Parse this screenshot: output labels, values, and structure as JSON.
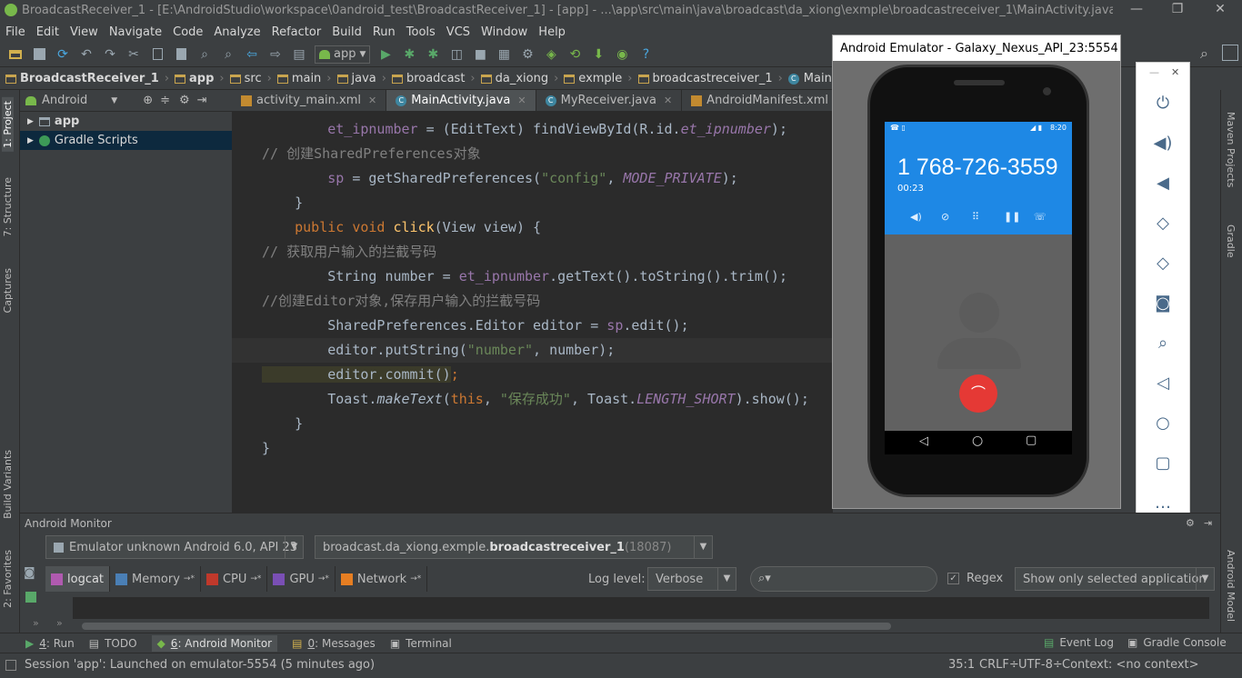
{
  "window": {
    "title": "BroadcastReceiver_1 - [E:\\AndroidStudio\\workspace\\0android_test\\BroadcastReceiver_1] - [app] - ...\\app\\src\\main\\java\\broadcast\\da_xiong\\exmple\\broadcastreceiver_1\\MainActivity.java - Android Studio ...",
    "minimize": "—",
    "restore": "❐",
    "close": "✕"
  },
  "menu": [
    "File",
    "Edit",
    "View",
    "Navigate",
    "Code",
    "Analyze",
    "Refactor",
    "Build",
    "Run",
    "Tools",
    "VCS",
    "Window",
    "Help"
  ],
  "toolbar": {
    "run_config": "app",
    "help": "?"
  },
  "breadcrumbs": [
    "BroadcastReceiver_1",
    "app",
    "src",
    "main",
    "java",
    "broadcast",
    "da_xiong",
    "exmple",
    "broadcastreceiver_1",
    "MainActivity"
  ],
  "left_tools": {
    "project": "1: Project",
    "structure": "7: Structure",
    "captures": "Captures",
    "build_variants": "Build Variants",
    "favorites": "2: Favorites"
  },
  "right_tools": {
    "maven": "Maven Projects",
    "gradle": "Gradle",
    "android_model": "Android Model"
  },
  "project_panel": {
    "view": "Android",
    "items": [
      "app",
      "Gradle Scripts"
    ]
  },
  "editor_tabs": [
    {
      "label": "activity_main.xml",
      "icon": "xml"
    },
    {
      "label": "MainActivity.java",
      "icon": "C"
    },
    {
      "label": "MyReceiver.java",
      "icon": "C"
    },
    {
      "label": "AndroidManifest.xml",
      "icon": "xml"
    }
  ],
  "code": {
    "l1a": "        et_ipnumber",
    "l1b": " = (EditText) findViewById(R.id.",
    "l1c": "et_ipnumber",
    "l1d": ");",
    "l2": "// 创建SharedPreferences对象",
    "l3a": "        sp",
    "l3b": " = getSharedPreferences(",
    "l3c": "\"config\"",
    "l3d": ", ",
    "l3e": "MODE_PRIVATE",
    "l3f": ");",
    "l4": "    }",
    "l5a": "    public void ",
    "l5b": "click",
    "l5c": "(View view) {",
    "l6": "// 获取用户输入的拦截号码",
    "l7a": "        String number = ",
    "l7b": "et_ipnumber",
    "l7c": ".getText().toString().trim();",
    "l8": "//创建Editor对象,保存用户输入的拦截号码",
    "l9a": "        SharedPreferences.Editor editor = ",
    "l9b": "sp",
    "l9c": ".edit();",
    "l10a": "        editor.putString(",
    "l10b": "\"number\"",
    "l10c": ", number);",
    "l11a": "        editor.commit()",
    "l11b": ";",
    "l12a": "        Toast.",
    "l12b": "makeText",
    "l12c": "(",
    "l12d": "this",
    "l12e": ", ",
    "l12f": "\"保存成功\"",
    "l12g": ", Toast.",
    "l12h": "LENGTH_SHORT",
    "l12i": ").show();",
    "l13": "    }",
    "l14": "}"
  },
  "emulator": {
    "title": "Android Emulator - Galaxy_Nexus_API_23:5554",
    "status_time": "8:20",
    "phone_number": "1 768-726-3559",
    "call_timer": "00:23"
  },
  "monitor": {
    "title": "Android Monitor",
    "device": "Emulator unknown Android 6.0, API 23",
    "process_prefix": "broadcast.da_xiong.exmple.",
    "process_bold": "broadcastreceiver_1",
    "process_pid": " (18087)",
    "tabs": [
      "logcat",
      "Memory",
      "CPU",
      "GPU",
      "Network"
    ],
    "log_level_label": "Log level:",
    "log_level": "Verbose",
    "search_placeholder": "",
    "regex": "Regex",
    "filter": "Show only selected application"
  },
  "bottom_tabs": [
    {
      "key": "4",
      "label": ": Run"
    },
    {
      "key": "",
      "label": "TODO"
    },
    {
      "key": "6",
      "label": ": Android Monitor"
    },
    {
      "key": "0",
      "label": ": Messages"
    },
    {
      "key": "",
      "label": "Terminal"
    }
  ],
  "bottom_right": {
    "event_log": "Event Log",
    "gradle_console": "Gradle Console"
  },
  "status": {
    "message": "Session 'app': Launched on emulator-5554 (5 minutes ago)",
    "position": "35:1",
    "line_sep": "CRLF÷",
    "encoding": "UTF-8÷",
    "context": "Context: <no context>"
  },
  "colors": {
    "bg": "#3c3f41",
    "editor_bg": "#2b2b2b",
    "call_blue": "#1e88e5",
    "end_call": "#e53935"
  }
}
